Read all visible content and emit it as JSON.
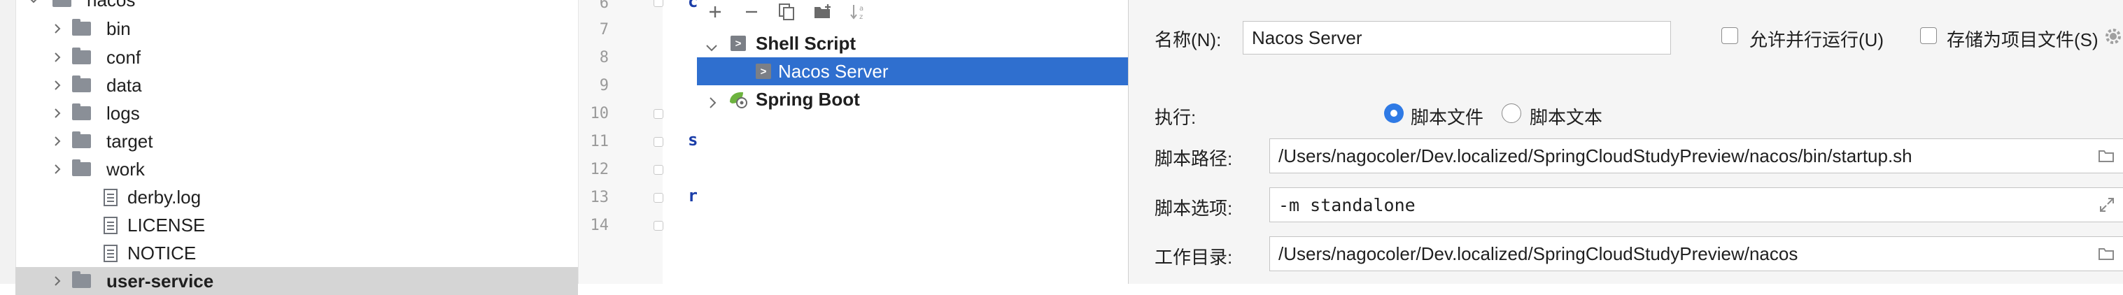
{
  "project_tree": {
    "items": [
      {
        "label": "nacos",
        "type": "folder",
        "expanded": true
      },
      {
        "label": "bin",
        "type": "folder",
        "expanded": false
      },
      {
        "label": "conf",
        "type": "folder",
        "expanded": false
      },
      {
        "label": "data",
        "type": "folder",
        "expanded": false
      },
      {
        "label": "logs",
        "type": "folder",
        "expanded": false
      },
      {
        "label": "target",
        "type": "folder",
        "expanded": false
      },
      {
        "label": "work",
        "type": "folder",
        "expanded": false
      },
      {
        "label": "derby.log",
        "type": "file"
      },
      {
        "label": "LICENSE",
        "type": "file"
      },
      {
        "label": "NOTICE",
        "type": "file"
      },
      {
        "label": "user-service",
        "type": "folder",
        "expanded": false
      }
    ]
  },
  "editor": {
    "line_numbers": [
      "6",
      "7",
      "8",
      "9",
      "10",
      "11",
      "12",
      "13",
      "14"
    ],
    "code_fragments": [
      "c",
      "s",
      "r"
    ]
  },
  "dialog": {
    "toolbar": {
      "add_icon": "plus-icon",
      "remove_icon": "minus-icon",
      "copy_icon": "copy-icon",
      "move_to_folder_icon": "folder-add-icon",
      "sort_icon": "sort-alpha-icon"
    },
    "config_tree": {
      "groups": [
        {
          "label": "Shell Script",
          "expanded": true,
          "icon": "shell-script-icon",
          "children": [
            {
              "label": "Nacos Server",
              "selected": true,
              "icon": "shell-script-icon"
            }
          ]
        },
        {
          "label": "Spring Boot",
          "expanded": false,
          "icon": "spring-boot-icon"
        }
      ]
    },
    "form": {
      "name_label": "名称(N):",
      "name_value": "Nacos Server",
      "allow_parallel_label": "允许并行运行(U)",
      "store_as_project_label": "存储为项目文件(S)",
      "execute_label": "执行:",
      "radio_script_file": "脚本文件",
      "radio_script_text": "脚本文本",
      "script_path_label": "脚本路径:",
      "script_path_value": "/Users/nagocoler/Dev.localized/SpringCloudStudyPreview/nacos/bin/startup.sh",
      "script_options_label": "脚本选项:",
      "script_options_value": "-m standalone",
      "working_dir_label": "工作目录:",
      "working_dir_value": "/Users/nagocoler/Dev.localized/SpringCloudStudyPreview/nacos"
    },
    "colors": {
      "selection": "#2f6fcf",
      "radio_accent": "#2f7ae5"
    }
  }
}
